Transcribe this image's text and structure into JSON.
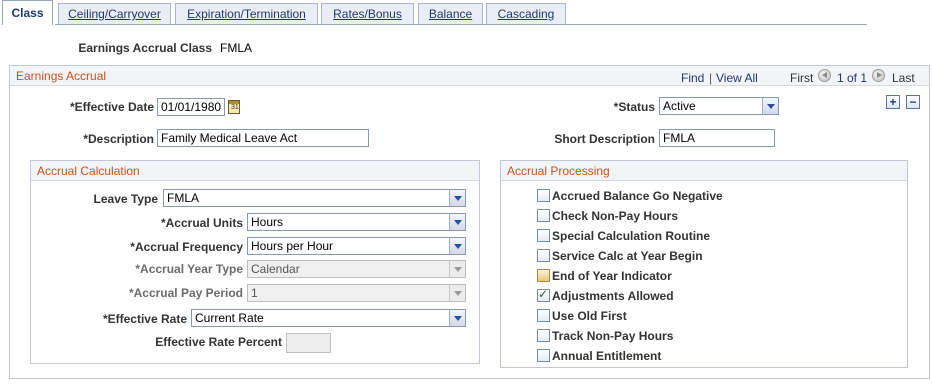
{
  "tabs": [
    {
      "label": "Class",
      "active": true
    },
    {
      "label": "Ceiling/Carryover",
      "active": false
    },
    {
      "label": "Expiration/Termination",
      "active": false
    },
    {
      "label": "Rates/Bonus",
      "active": false
    },
    {
      "label": "Balance",
      "active": false
    },
    {
      "label": "Cascading",
      "active": false
    }
  ],
  "header": {
    "earnings_accrual_class_label": "Earnings Accrual Class",
    "earnings_accrual_class_value": "FMLA"
  },
  "earnings_accrual": {
    "title": "Earnings Accrual",
    "find_link": "Find",
    "separator": "|",
    "view_all_link": "View All",
    "first_label": "First",
    "page_status": "1 of 1",
    "last_label": "Last",
    "add_row": "+",
    "delete_row": "−",
    "effective_date_label": "*Effective Date",
    "effective_date_value": "01/01/1980",
    "calendar_icon_text": "31",
    "status_label": "*Status",
    "status_value": "Active",
    "description_label": "*Description",
    "description_value": "Family Medical Leave Act",
    "short_description_label": "Short Description",
    "short_description_value": "FMLA"
  },
  "accrual_calculation": {
    "title": "Accrual Calculation",
    "leave_type_label": "Leave Type",
    "leave_type_value": "FMLA",
    "accrual_units_label": "*Accrual Units",
    "accrual_units_value": "Hours",
    "accrual_frequency_label": "*Accrual Frequency",
    "accrual_frequency_value": "Hours per Hour",
    "accrual_year_type_label": "*Accrual Year Type",
    "accrual_year_type_value": "Calendar",
    "accrual_pay_period_label": "*Accrual Pay Period",
    "accrual_pay_period_value": "1",
    "effective_rate_label": "*Effective Rate",
    "effective_rate_value": "Current Rate",
    "effective_rate_percent_label": "Effective Rate Percent",
    "effective_rate_percent_value": ""
  },
  "accrual_processing": {
    "title": "Accrual Processing",
    "checkboxes": [
      {
        "label": "Accrued Balance Go Negative",
        "checked": false
      },
      {
        "label": "Check Non-Pay Hours",
        "checked": false
      },
      {
        "label": "Special Calculation Routine",
        "checked": false
      },
      {
        "label": "Service Calc at Year Begin",
        "checked": false
      },
      {
        "label": "End of Year Indicator",
        "checked": false
      },
      {
        "label": "Adjustments Allowed",
        "checked": true
      },
      {
        "label": "Use Old First",
        "checked": false
      },
      {
        "label": "Track Non-Pay Hours",
        "checked": false
      },
      {
        "label": "Annual Entitlement",
        "checked": false
      }
    ]
  },
  "colors": {
    "accent_orange": "#c9541a",
    "link_blue": "#22386b",
    "border": "#c3c9d4"
  }
}
